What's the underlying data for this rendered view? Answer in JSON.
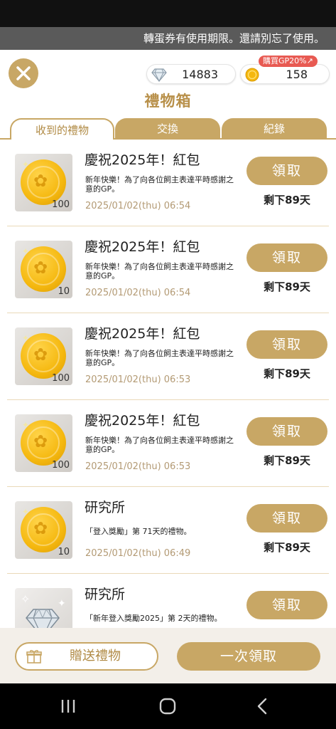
{
  "notice": "轉蛋券有使用期限。還請別忘了使用。",
  "currency": {
    "gems": "14883",
    "gp": "158",
    "promo": "購買GP20%↗"
  },
  "title": "禮物箱",
  "tabs": [
    {
      "label": "收到的禮物"
    },
    {
      "label": "交換"
    },
    {
      "label": "紀錄"
    }
  ],
  "gifts": [
    {
      "name": "慶祝2025年！紅包",
      "desc": "新年快樂！為了向各位飼主表達平時感謝之意的GP。",
      "date": "2025/01/02(thu) 06:54",
      "qty": "100",
      "icon": "gold-coin-icon",
      "claim": "領取",
      "remain": "剩下89天"
    },
    {
      "name": "慶祝2025年！紅包",
      "desc": "新年快樂！為了向各位飼主表達平時感謝之意的GP。",
      "date": "2025/01/02(thu) 06:54",
      "qty": "10",
      "icon": "gold-coin-icon",
      "claim": "領取",
      "remain": "剩下89天"
    },
    {
      "name": "慶祝2025年！紅包",
      "desc": "新年快樂！為了向各位飼主表達平時感謝之意的GP。",
      "date": "2025/01/02(thu) 06:53",
      "qty": "100",
      "icon": "gold-coin-icon",
      "claim": "領取",
      "remain": "剩下89天"
    },
    {
      "name": "慶祝2025年！紅包",
      "desc": "新年快樂！為了向各位飼主表達平時感謝之意的GP。",
      "date": "2025/01/02(thu) 06:53",
      "qty": "100",
      "icon": "gold-coin-icon",
      "claim": "領取",
      "remain": "剩下89天"
    },
    {
      "name": "研究所",
      "desc": "「登入獎勵」第 71天的禮物。",
      "date": "2025/01/02(thu) 06:49",
      "qty": "10",
      "icon": "gold-coin-icon",
      "claim": "領取",
      "remain": "剩下89天"
    },
    {
      "name": "研究所",
      "desc": "「新年登入獎勵2025」第 2天的禮物。",
      "date": "",
      "qty": "",
      "icon": "diamond-icon",
      "claim": "領取",
      "remain": ""
    }
  ],
  "footer": {
    "send_gift": "贈送禮物",
    "claim_all": "一次領取"
  },
  "colors": {
    "gold": "#c8a765",
    "gold_text": "#b08a44",
    "promo": "#e85a52"
  }
}
